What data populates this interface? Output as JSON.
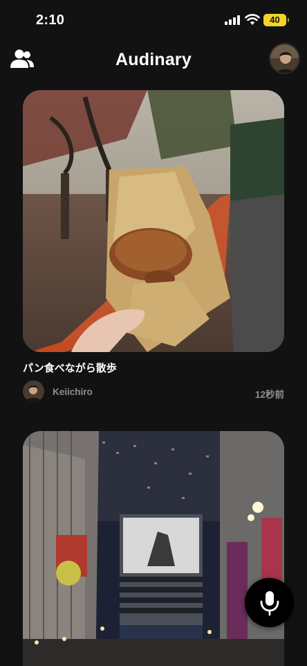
{
  "status_bar": {
    "time": "2:10",
    "battery_level": "40"
  },
  "header": {
    "title": "Audinary",
    "friends_icon": "friends-icon",
    "profile_icon": "user-avatar"
  },
  "posts": [
    {
      "caption": "パン食べながら散歩",
      "author": "Keiichiro",
      "time_ago": "12秒前",
      "image_subject": "bagel-in-paper-bag-park"
    },
    {
      "image_subject": "shinjuku-city-night"
    }
  ],
  "mic_button": {
    "icon": "microphone-icon"
  },
  "colors": {
    "background": "#121212",
    "secondary_text": "#8f8f8f",
    "battery": "#f2d327"
  }
}
